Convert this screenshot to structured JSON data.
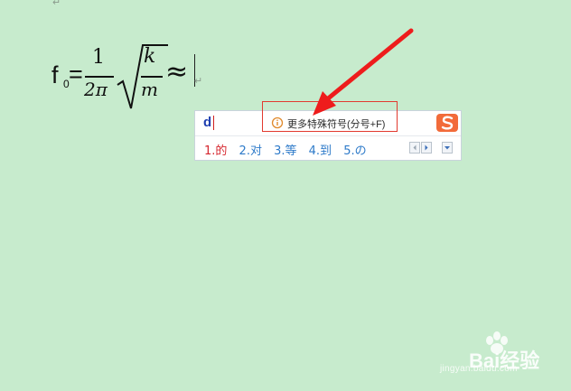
{
  "document": {
    "paragraph_mark": "↵",
    "formula": {
      "f": "f",
      "subscript": "0",
      "equals": "=",
      "numerator": "1",
      "denominator": "2π",
      "radicand_numerator": "k",
      "radicand_denominator": "m",
      "inserted_symbol": "≈"
    }
  },
  "ime": {
    "input_text": "d",
    "hint": "更多特殊符号(分号+F)",
    "candidates": [
      "1.的",
      "2.对",
      "3.等",
      "4.到",
      "5.の"
    ]
  },
  "watermark": {
    "brand": "Bai经验",
    "url": "jingyan.baidu.com"
  },
  "colors": {
    "background": "#c7ebcd",
    "annotation": "#e23a2f",
    "candidate_first": "#d6262e",
    "candidate": "#2d7ac9"
  }
}
